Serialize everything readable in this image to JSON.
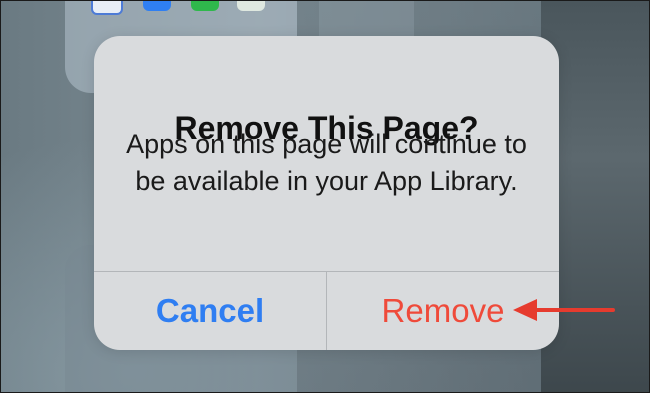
{
  "dialog": {
    "title": "Remove This Page?",
    "message": "Apps on this page will continue to be available in your App Library.",
    "cancel_label": "Cancel",
    "remove_label": "Remove"
  },
  "colors": {
    "cancel": "#2f7ef2",
    "remove": "#ef4a3a",
    "arrow": "#e63b2e",
    "dialog_bg": "#d9dbdd"
  },
  "icons": {
    "home_screen_apps": [
      "calendar-app-icon",
      "app-store-icon",
      "messages-icon",
      "maps-icon"
    ],
    "annotation": "arrow-left-icon"
  }
}
